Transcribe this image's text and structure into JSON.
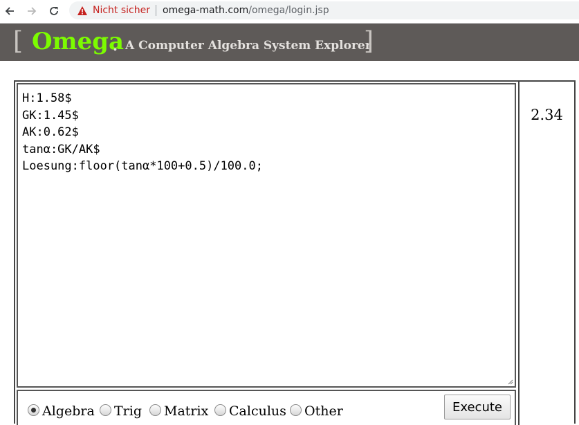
{
  "browser": {
    "security_label": "Nicht sicher",
    "url_host": "omega-math.com",
    "url_path": "/omega/login.jsp"
  },
  "header": {
    "open_bracket": "[",
    "brand": "Omega",
    "dot": ".",
    "tagline": "A Computer Algebra System Explorer",
    "close_bracket": "]",
    "brand_color": "#7cfc00",
    "banner_color": "#5e5a58"
  },
  "editor": {
    "content": "H:1.58$\nGK:1.45$\nAK:0.62$\ntanα:GK/AK$\nLoesung:floor(tanα*100+0.5)/100.0;"
  },
  "result": {
    "value": "2.34"
  },
  "modes": {
    "options": [
      "Algebra",
      "Trig",
      "Matrix",
      "Calculus",
      "Other"
    ],
    "selected": "Algebra"
  },
  "execute_label": "Execute"
}
